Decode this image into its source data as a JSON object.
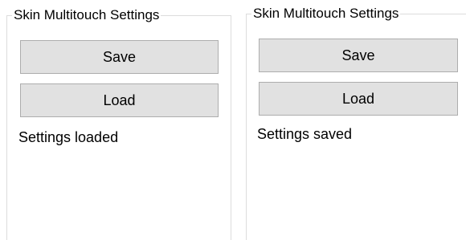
{
  "panels": [
    {
      "title": "Skin Multitouch Settings",
      "save_label": "Save",
      "load_label": "Load",
      "status": "Settings loaded"
    },
    {
      "title": "Skin Multitouch Settings",
      "save_label": "Save",
      "load_label": "Load",
      "status": "Settings saved"
    }
  ]
}
